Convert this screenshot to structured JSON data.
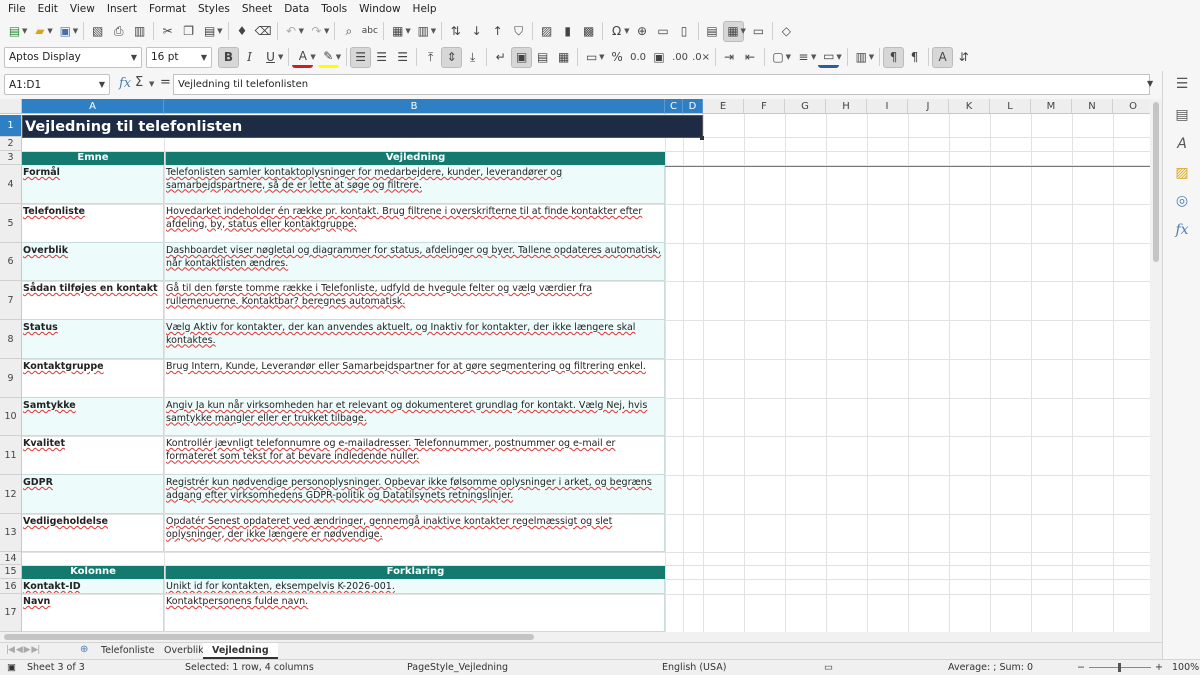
{
  "menu": [
    "File",
    "Edit",
    "View",
    "Insert",
    "Format",
    "Styles",
    "Sheet",
    "Data",
    "Tools",
    "Window",
    "Help"
  ],
  "toolbar": {
    "font_name": "Aptos Display",
    "font_size": "16 pt"
  },
  "formula_bar": {
    "name_box": "A1:D1",
    "content": "Vejledning til telefonlisten"
  },
  "columns": [
    "A",
    "B",
    "C",
    "D",
    "E",
    "F",
    "G",
    "H",
    "I",
    "J",
    "K",
    "L",
    "M",
    "N",
    "O"
  ],
  "rows": [
    "1",
    "2",
    "3",
    "4",
    "5",
    "6",
    "7",
    "8",
    "9",
    "10",
    "11",
    "12",
    "13",
    "14",
    "15",
    "16",
    "17"
  ],
  "sheet": {
    "title": "Vejledning til telefonlisten",
    "header1": {
      "col_a": "Emne",
      "col_b": "Vejledning"
    },
    "guide": [
      {
        "topic": "Formål",
        "text": "Telefonlisten samler kontaktoplysninger for medarbejdere, kunder, leverandører og samarbejdspartnere, så de er lette at søge og filtrere."
      },
      {
        "topic": "Telefonliste",
        "text": "Hovedarket indeholder én række pr. kontakt. Brug filtrene i overskrifterne til at finde kontakter efter afdeling, by, status eller kontaktgruppe."
      },
      {
        "topic": "Overblik",
        "text": "Dashboardet viser nøgletal og diagrammer for status, afdelinger og byer. Tallene opdateres automatisk, når kontaktlisten ændres."
      },
      {
        "topic": "Sådan tilføjes en kontakt",
        "text": "Gå til den første tomme række i Telefonliste, udfyld de hvegule felter og vælg værdier fra rullemenuerne. Kontaktbar? beregnes automatisk."
      },
      {
        "topic": "Status",
        "text": "Vælg Aktiv for kontakter, der kan anvendes aktuelt, og Inaktiv for kontakter, der ikke længere skal kontaktes."
      },
      {
        "topic": "Kontaktgruppe",
        "text": "Brug Intern, Kunde, Leverandør eller Samarbejdspartner for at gøre segmentering og filtrering enkel."
      },
      {
        "topic": "Samtykke",
        "text": "Angiv Ja kun når virksomheden har et relevant og dokumenteret grundlag for kontakt. Vælg Nej, hvis samtykke mangler eller er trukket tilbage."
      },
      {
        "topic": "Kvalitet",
        "text": "Kontrollér jævnligt telefonnumre og e-mailadresser. Telefonnummer, postnummer og e-mail er formateret som tekst for at bevare indledende nuller."
      },
      {
        "topic": "GDPR",
        "text": "Registrér kun nødvendige personoplysninger. Opbevar ikke følsomme oplysninger i arket, og begræns adgang efter virksomhedens GDPR-politik og Datatilsynets retningslinjer."
      },
      {
        "topic": "Vedligeholdelse",
        "text": "Opdatér Senest opdateret ved ændringer, gennemgå inaktive kontakter regelmæssigt og slet oplysninger, der ikke længere er nødvendige."
      }
    ],
    "header2": {
      "col_a": "Kolonne",
      "col_b": "Forklaring"
    },
    "columns_help": [
      {
        "topic": "Kontakt-ID",
        "text": "Unikt id for kontakten, eksempelvis K-2026-001."
      },
      {
        "topic": "Navn",
        "text": "Kontaktpersonens fulde navn."
      }
    ]
  },
  "tabs": [
    "Telefonliste",
    "Overblik",
    "Vejledning"
  ],
  "active_tab": "Vejledning",
  "status": {
    "sheet": "Sheet 3 of 3",
    "selection": "Selected: 1 row, 4 columns",
    "page_style": "PageStyle_Vejledning",
    "language": "English (USA)",
    "sum": "Average: ; Sum: 0",
    "zoom": "100%"
  },
  "colors": {
    "title_bg": "#1d2b45",
    "header_bg": "#147a6f",
    "alt_row": "#eefbfb",
    "selection": "#2f7fc5"
  }
}
